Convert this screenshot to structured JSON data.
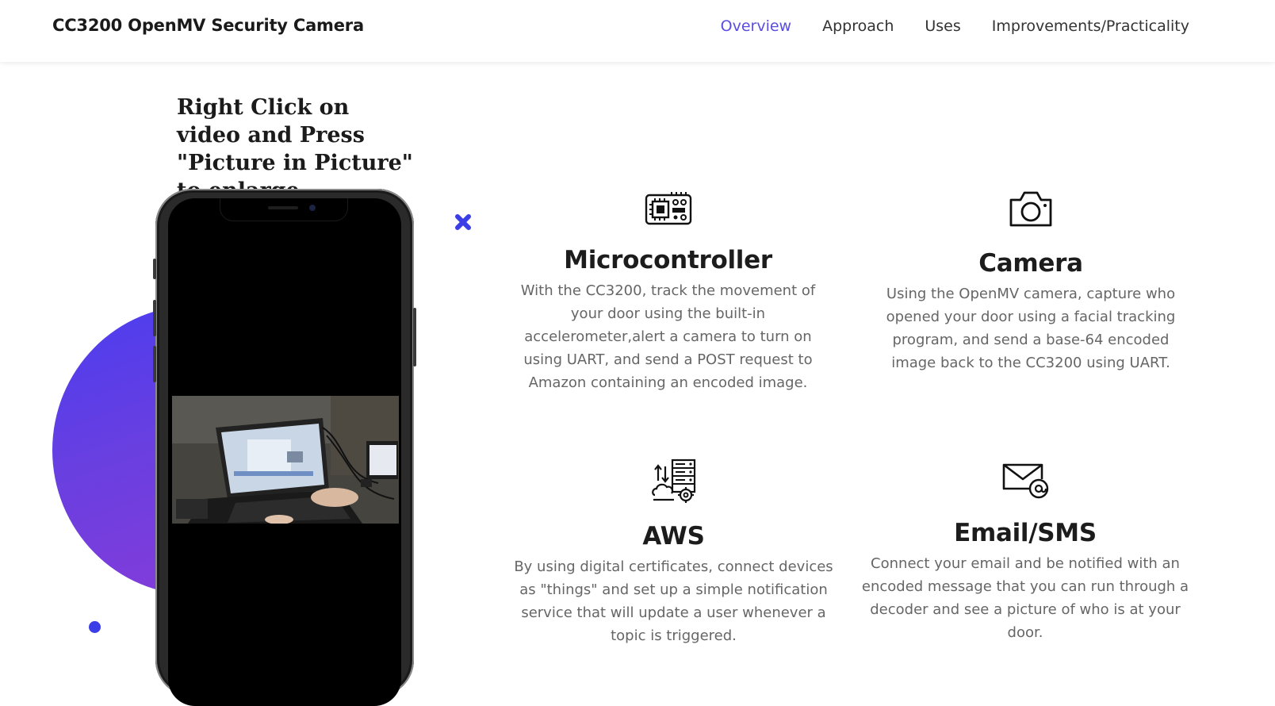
{
  "header": {
    "brand": "CC3200 OpenMV Security Camera",
    "nav": [
      "Overview",
      "Approach",
      "Uses",
      "Improvements/Practicality"
    ],
    "active_nav": "Overview"
  },
  "hero": {
    "instruction": "Right Click on video and Press \"Picture in Picture\" to enlarge"
  },
  "features": [
    {
      "icon": "circuit-board-icon",
      "title": "Microcontroller",
      "description": "With the CC3200, track the movement of your door using the built-in accelerometer,alert a camera to turn on using UART, and send a POST request to Amazon containing an encoded image."
    },
    {
      "icon": "camera-icon",
      "title": "Camera",
      "description": "Using the OpenMV camera, capture who opened your door using a facial tracking program, and send a base-64 encoded image back to the CC3200 using UART."
    },
    {
      "icon": "cloud-server-icon",
      "title": "AWS",
      "description": "By using digital certificates, connect devices as \"things\" and set up a simple notification service that will update a user whenever a topic is triggered."
    },
    {
      "icon": "email-icon",
      "title": "Email/SMS",
      "description": "Connect your email and be notified with an encoded message that you can run through a decoder and see a picture of who is at your door."
    }
  ],
  "colors": {
    "accent": "#5a4de0",
    "blob_start": "#4a3df0",
    "blob_end": "#8a3bd8",
    "dot": "#3b3de6"
  }
}
